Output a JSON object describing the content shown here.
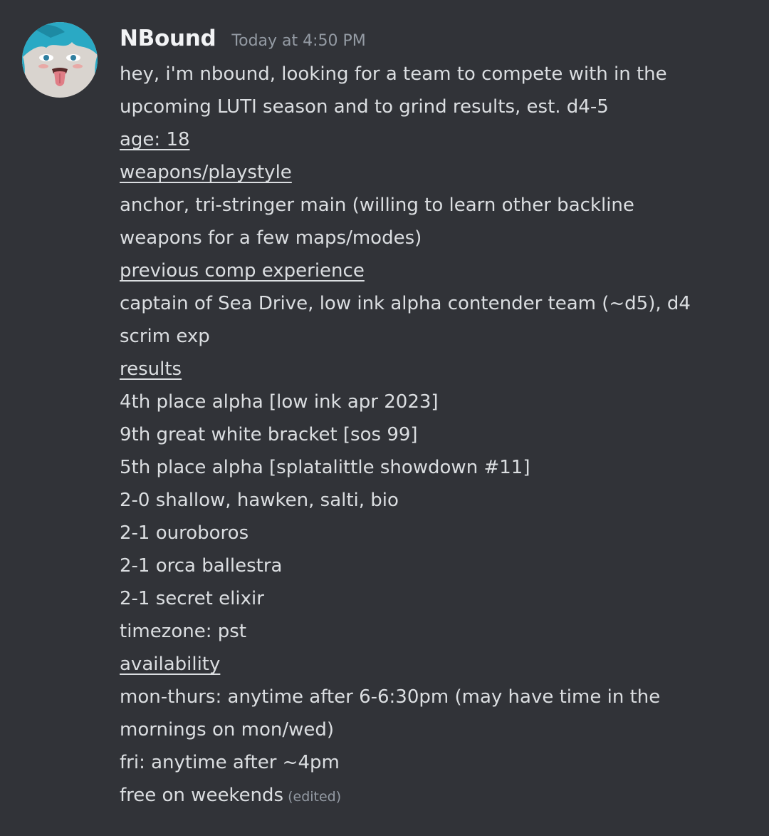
{
  "author": {
    "name": "NBound",
    "timestamp": "Today at 4:50 PM",
    "avatar_icon": "anime-avatar-icon"
  },
  "colors": {
    "background": "#313338",
    "text": "#dbdee1",
    "username": "#f2f3f5",
    "muted": "#949ba4",
    "avatar_hair": "#2aa9c4"
  },
  "message": {
    "lines": [
      "hey, i'm nbound, looking for a team to compete with in the",
      "upcoming LUTI season and to grind results, est. d4-5",
      "age: 18",
      "weapons/playstyle",
      "anchor, tri-stringer main (willing to learn other backline",
      "weapons for a few maps/modes)",
      "previous comp experience",
      "captain of Sea Drive, low ink alpha contender team (~d5), d4",
      "scrim exp",
      "results",
      "4th place alpha [low ink apr 2023]",
      "9th great white bracket [sos 99]",
      "5th place alpha [splatalittle showdown #11]",
      "2-0 shallow, hawken, salti, bio",
      "2-1 ouroboros",
      "2-1 orca ballestra",
      "2-1 secret elixir",
      "timezone: pst",
      "availability",
      "mon-thurs: anytime after 6-6:30pm (may have time in the",
      "mornings on mon/wed)",
      "fri: anytime after ~4pm",
      "free on weekends"
    ],
    "edited_label": "(edited)"
  }
}
